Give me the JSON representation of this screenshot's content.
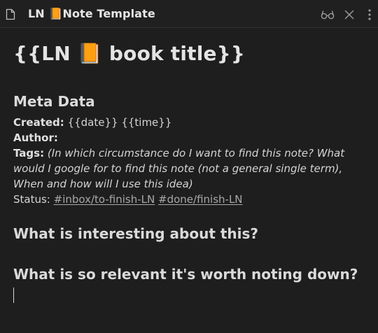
{
  "window": {
    "title": "LN 📙Note Template",
    "icons": {
      "file": "file-icon",
      "reading_mode": "glasses-icon",
      "close": "close-icon",
      "more": "more-options-icon"
    }
  },
  "note": {
    "title": "{{LN 📙 book title}}",
    "meta_heading": "Meta Data",
    "created_label": "Created:",
    "created_value": " {{date}} {{time}}",
    "author_label": "Author:",
    "tags_label": "Tags:",
    "tags_value": " (In which circumstance do I want to find this note? What would I google for to find this note (not a general single term), When and how will I use this idea)",
    "status_label": "Status:",
    "status_tags": [
      "#inbox/to-finish-LN",
      "#done/finish-LN"
    ],
    "heading_interesting": "What is interesting about this?",
    "heading_relevant": "What is so relevant it's worth noting down?"
  }
}
